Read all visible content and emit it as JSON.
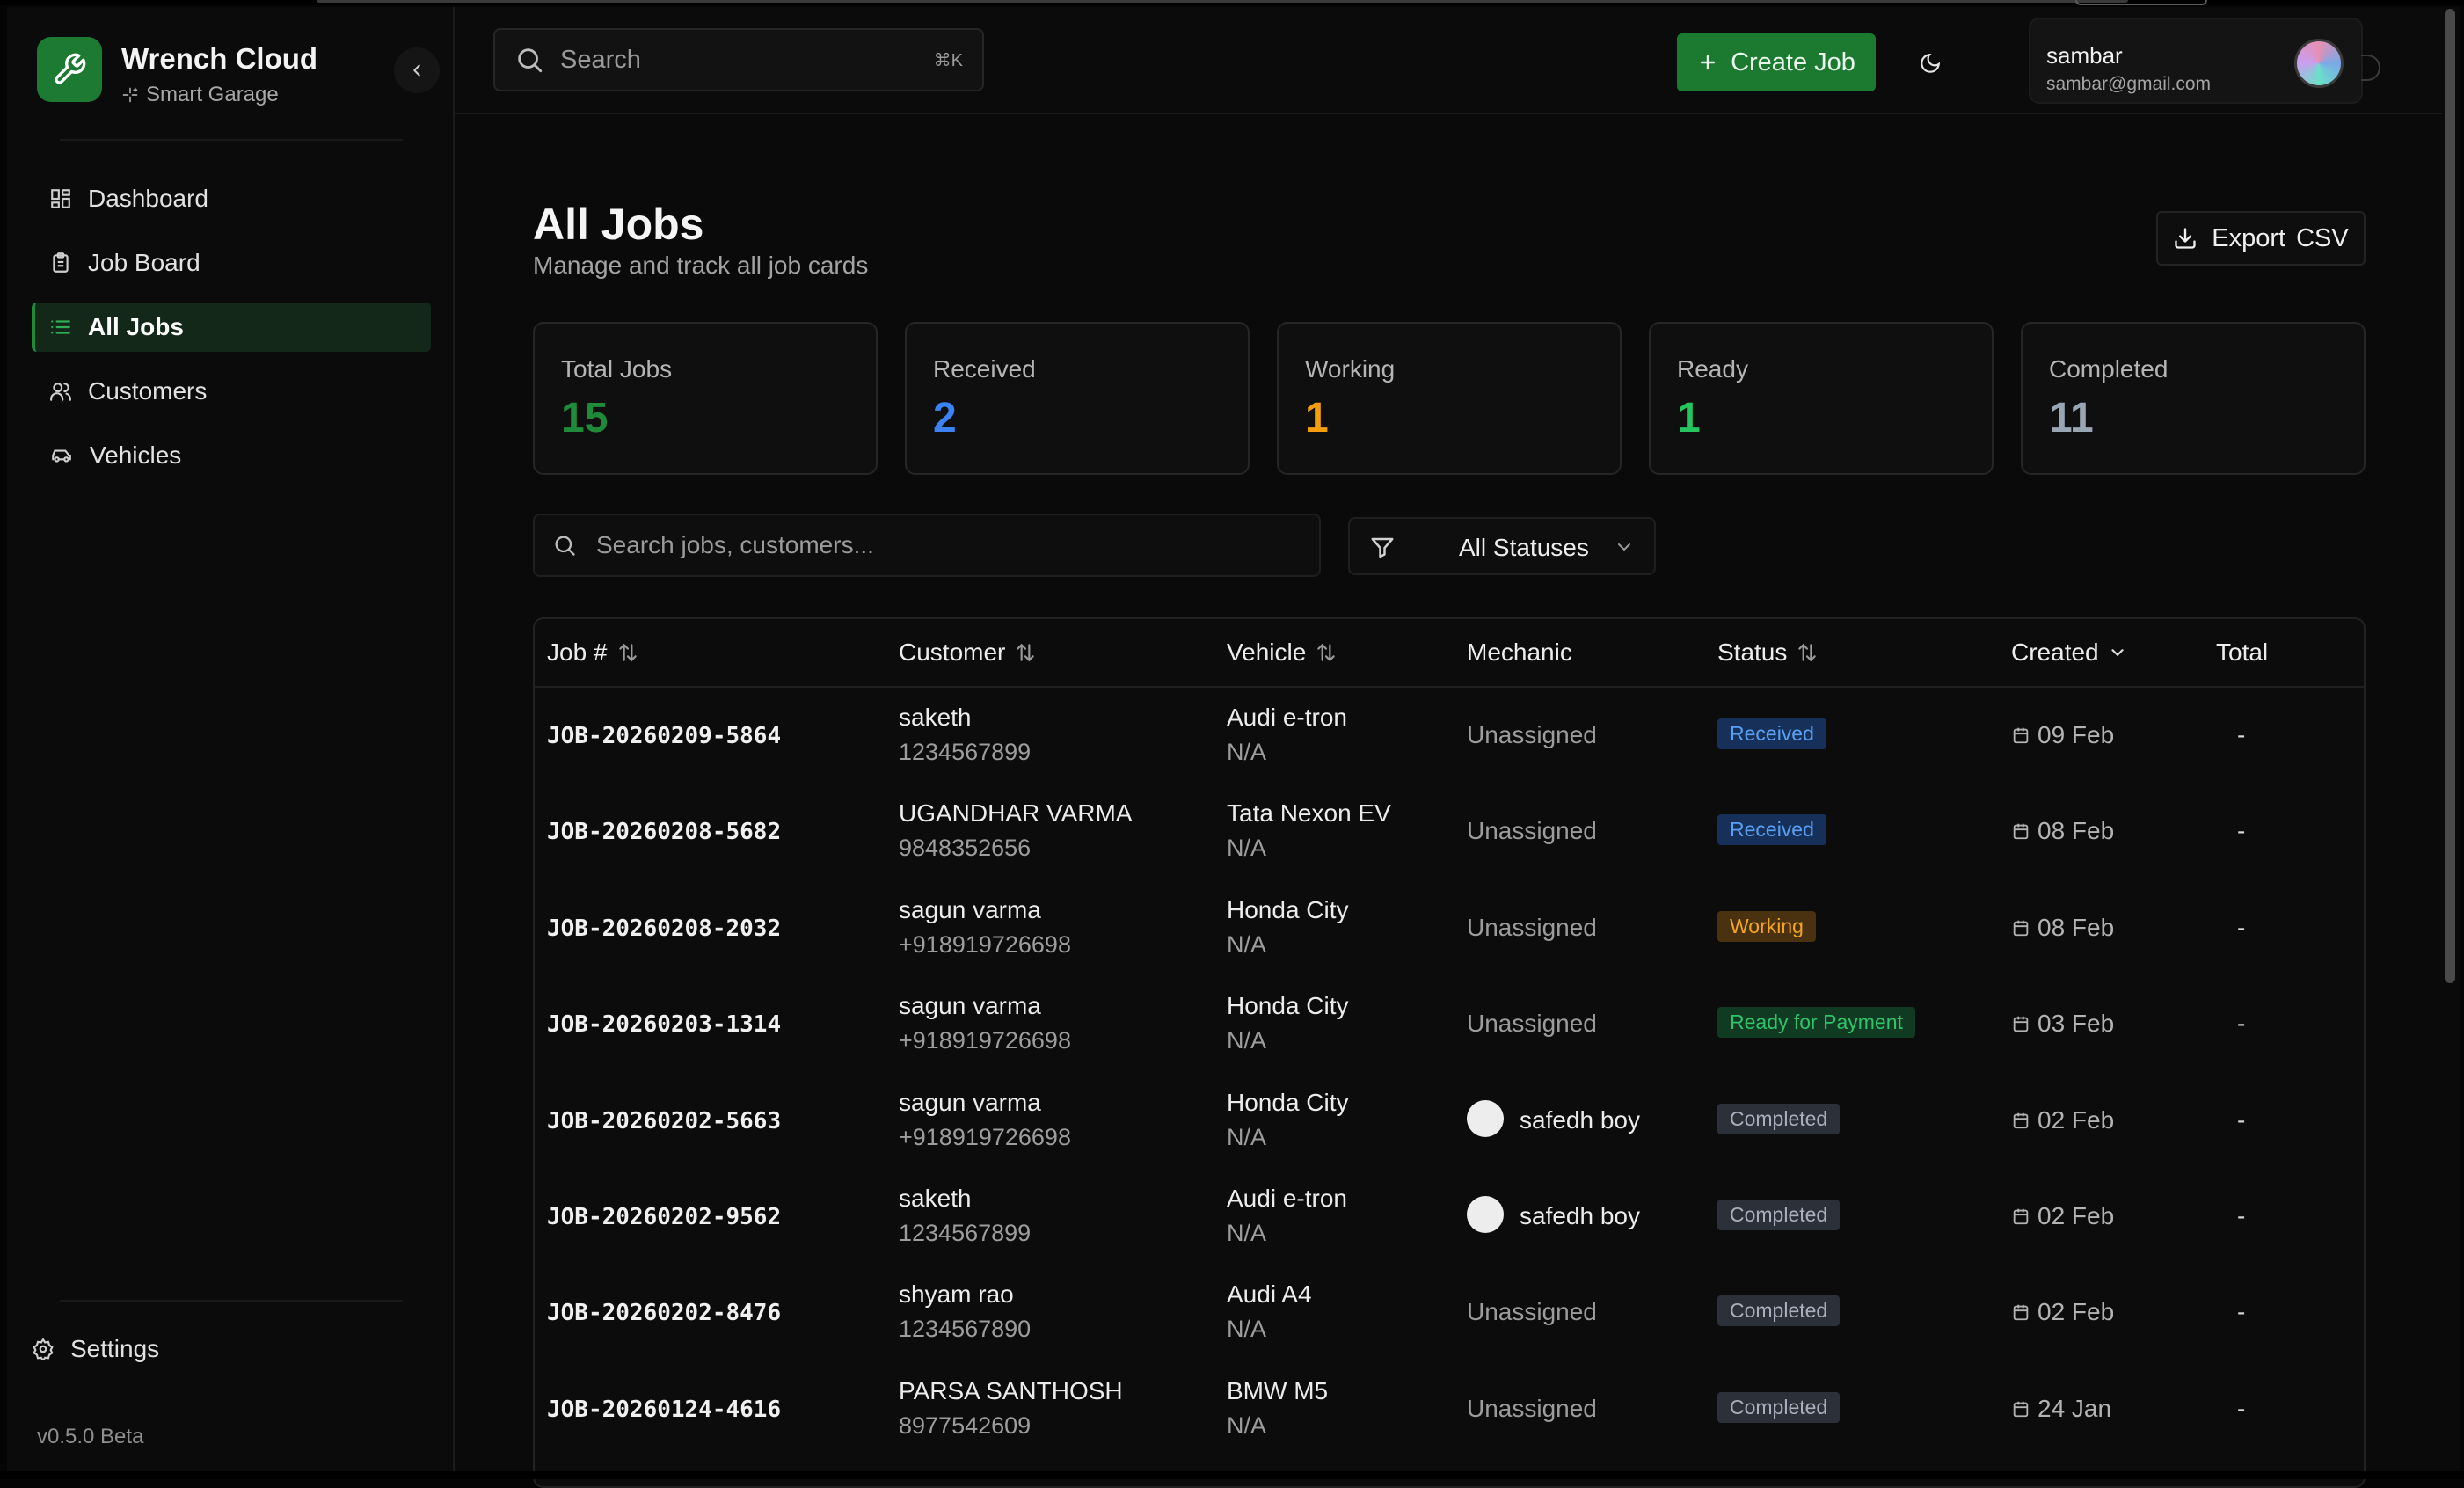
{
  "brand": {
    "name": "Wrench Cloud",
    "subtitle": "Smart Garage"
  },
  "sidebar": {
    "items": [
      {
        "label": "Dashboard",
        "icon": "dashboard-icon"
      },
      {
        "label": "Job Board",
        "icon": "clipboard-icon"
      },
      {
        "label": "All Jobs",
        "icon": "list-icon",
        "active": true
      },
      {
        "label": "Customers",
        "icon": "users-icon"
      },
      {
        "label": "Vehicles",
        "icon": "car-icon"
      }
    ],
    "settings_label": "Settings",
    "version": "v0.5.0 Beta"
  },
  "header": {
    "search_placeholder": "Search",
    "search_shortcut": "⌘K",
    "create_job_label": "Create Job",
    "user": {
      "name": "sambar",
      "email": "sambar@gmail.com"
    }
  },
  "page": {
    "title": "All Jobs",
    "subtitle": "Manage and track all job cards",
    "export_label": "Export",
    "export_label_suffix": "CSV"
  },
  "stats": [
    {
      "label": "Total Jobs",
      "value": "15",
      "color": "#1f8a3a"
    },
    {
      "label": "Received",
      "value": "2",
      "color": "#3b82f6"
    },
    {
      "label": "Working",
      "value": "1",
      "color": "#f59e0b"
    },
    {
      "label": "Ready",
      "value": "1",
      "color": "#22c55e"
    },
    {
      "label": "Completed",
      "value": "11",
      "color": "#9aa5b4"
    }
  ],
  "filters": {
    "search_placeholder": "Search jobs, customers...",
    "status_selected": "All Statuses"
  },
  "table": {
    "columns": [
      "Job #",
      "Customer",
      "Vehicle",
      "Mechanic",
      "Status",
      "Created",
      "Total"
    ],
    "rows": [
      {
        "job": "JOB-20260209-5864",
        "customer": "saketh",
        "phone": "1234567899",
        "vehicle": "Audi e-tron",
        "plate": "N/A",
        "mechanic": "Unassigned",
        "status": "Received",
        "created": "09 Feb",
        "total": "-"
      },
      {
        "job": "JOB-20260208-5682",
        "customer": "UGANDHAR VARMA",
        "phone": "9848352656",
        "vehicle": "Tata Nexon EV",
        "plate": "N/A",
        "mechanic": "Unassigned",
        "status": "Received",
        "created": "08 Feb",
        "total": "-"
      },
      {
        "job": "JOB-20260208-2032",
        "customer": "sagun varma",
        "phone": "+918919726698",
        "vehicle": "Honda City",
        "plate": "N/A",
        "mechanic": "Unassigned",
        "status": "Working",
        "created": "08 Feb",
        "total": "-"
      },
      {
        "job": "JOB-20260203-1314",
        "customer": "sagun varma",
        "phone": "+918919726698",
        "vehicle": "Honda City",
        "plate": "N/A",
        "mechanic": "Unassigned",
        "status": "Ready for Payment",
        "created": "03 Feb",
        "total": "-"
      },
      {
        "job": "JOB-20260202-5663",
        "customer": "sagun varma",
        "phone": "+918919726698",
        "vehicle": "Honda City",
        "plate": "N/A",
        "mechanic": "safedh boy",
        "status": "Completed",
        "created": "02 Feb",
        "total": "-"
      },
      {
        "job": "JOB-20260202-9562",
        "customer": "saketh",
        "phone": "1234567899",
        "vehicle": "Audi e-tron",
        "plate": "N/A",
        "mechanic": "safedh boy",
        "status": "Completed",
        "created": "02 Feb",
        "total": "-"
      },
      {
        "job": "JOB-20260202-8476",
        "customer": "shyam rao",
        "phone": "1234567890",
        "vehicle": "Audi A4",
        "plate": "N/A",
        "mechanic": "Unassigned",
        "status": "Completed",
        "created": "02 Feb",
        "total": "-"
      },
      {
        "job": "JOB-20260124-4616",
        "customer": "PARSA SANTHOSH",
        "phone": "8977542609",
        "vehicle": "BMW M5",
        "plate": "N/A",
        "mechanic": "Unassigned",
        "status": "Completed",
        "created": "24 Jan",
        "total": "-"
      }
    ]
  }
}
